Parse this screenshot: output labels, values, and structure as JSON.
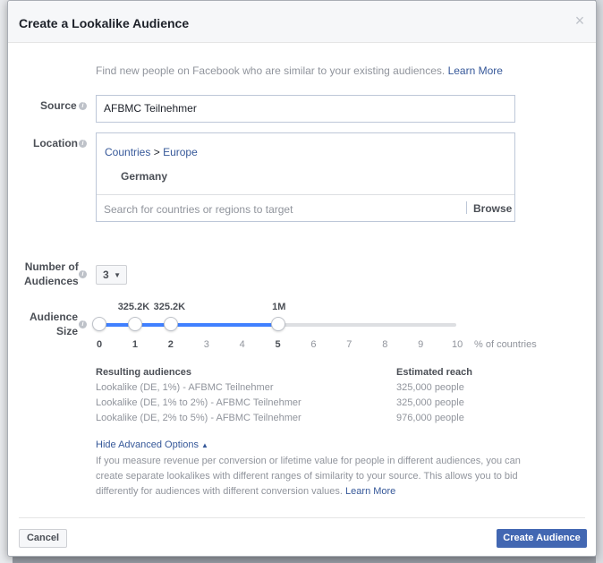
{
  "dialog": {
    "title": "Create a Lookalike Audience",
    "close_glyph": "×"
  },
  "intro": {
    "text": "Find new people on Facebook who are similar to your existing audiences.",
    "link": "Learn More"
  },
  "source": {
    "label": "Source",
    "value": "AFBMC Teilnehmer"
  },
  "location": {
    "label": "Location",
    "crumb_parent": "Countries",
    "crumb_sep": ">",
    "crumb_child": "Europe",
    "selected_country": "Germany",
    "search_placeholder": "Search for countries or regions to target",
    "browse_label": "Browse"
  },
  "number_of_audiences": {
    "label_line1": "Number of",
    "label_line2": "Audiences",
    "value": "3"
  },
  "audience_size": {
    "label_line1": "Audience",
    "label_line2": "Size",
    "knobs": [
      {
        "position": 0,
        "label": ""
      },
      {
        "position": 1,
        "label": "325.2K"
      },
      {
        "position": 2,
        "label": "325.2K"
      },
      {
        "position": 5,
        "label": "1M"
      }
    ],
    "ticks": [
      "0",
      "1",
      "2",
      "3",
      "4",
      "5",
      "6",
      "7",
      "8",
      "9",
      "10"
    ],
    "active_ticks": [
      "0",
      "1",
      "2",
      "5"
    ],
    "max": 10,
    "unit_label": "% of countries"
  },
  "results": {
    "col1_header": "Resulting audiences",
    "col2_header": "Estimated reach",
    "rows": [
      {
        "name": "Lookalike (DE, 1%) - AFBMC Teilnehmer",
        "reach": "325,000 people"
      },
      {
        "name": "Lookalike (DE, 1% to 2%) - AFBMC Teilnehmer",
        "reach": "325,000 people"
      },
      {
        "name": "Lookalike (DE, 2% to 5%) - AFBMC Teilnehmer",
        "reach": "976,000 people"
      }
    ]
  },
  "advanced": {
    "toggle_label": "Hide Advanced Options",
    "description": "If you measure revenue per conversion or lifetime value for people in different audiences, you can create separate lookalikes with different ranges of similarity to your source. This allows you to bid differently for audiences with different conversion values.",
    "link": "Learn More"
  },
  "footer": {
    "cancel_label": "Cancel",
    "create_label": "Create Audience"
  },
  "colors": {
    "primary": "#4267b2",
    "link": "#365899",
    "slider_fill": "#4080ff"
  }
}
